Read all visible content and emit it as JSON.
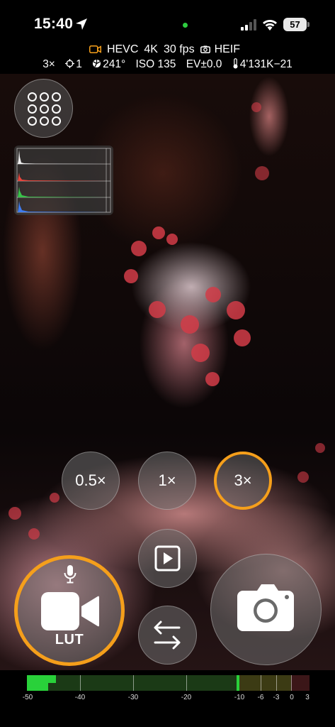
{
  "status_bar": {
    "time": "15:40",
    "battery": "57",
    "icons": [
      "location-arrow-icon",
      "signal-icon",
      "wifi-icon",
      "battery-icon"
    ]
  },
  "capture_info": {
    "codec": "HEVC",
    "resolution": "4K",
    "framerate": "30 fps",
    "photo_format": "HEIF",
    "zoom": "3×",
    "focus": "1",
    "shutter": "241°",
    "iso": "ISO 135",
    "ev": "EV±0.0",
    "white_balance": "4'131K−21"
  },
  "colors": {
    "accent": "#f59f1b",
    "meter_green": "#29d13a"
  },
  "zoom_options": [
    {
      "label": "0.5×",
      "active": false
    },
    {
      "label": "1×",
      "active": false
    },
    {
      "label": "3×",
      "active": true
    }
  ],
  "record_button": {
    "label": "LUT"
  },
  "audio_meter": {
    "labels": [
      "-50",
      "-40",
      "-30",
      "-20",
      "-10",
      "-6",
      "-3",
      "0",
      "3"
    ],
    "level_db": -45,
    "peak_db": -10
  }
}
